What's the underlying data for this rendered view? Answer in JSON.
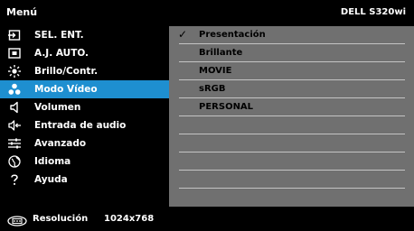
{
  "header": {
    "title": "Menú",
    "model": "DELL S320wi"
  },
  "menu": {
    "items": [
      {
        "label": "SEL. ENT.",
        "icon": "input-icon"
      },
      {
        "label": "A.J. AUTO.",
        "icon": "auto-adjust-icon"
      },
      {
        "label": "Brillo/Contr.",
        "icon": "brightness-icon"
      },
      {
        "label": "Modo Vídeo",
        "icon": "video-mode-icon",
        "active": true
      },
      {
        "label": "Volumen",
        "icon": "volume-icon"
      },
      {
        "label": "Entrada de audio",
        "icon": "audio-input-icon"
      },
      {
        "label": "Avanzado",
        "icon": "advanced-icon"
      },
      {
        "label": "Idioma",
        "icon": "language-icon"
      },
      {
        "label": "Ayuda",
        "icon": "help-icon"
      }
    ]
  },
  "submenu": {
    "items": [
      {
        "label": "Presentación",
        "checked": true,
        "check": "✓"
      },
      {
        "label": "Brillante",
        "checked": false
      },
      {
        "label": "MOVIE",
        "checked": false
      },
      {
        "label": "sRGB",
        "checked": false
      },
      {
        "label": "PERSONAL",
        "checked": false
      }
    ],
    "empty_rows": 5
  },
  "footer": {
    "label": "Resolución",
    "value": "1024x768",
    "icon": "resolution-icon"
  },
  "colors": {
    "highlight": "#1e8fd0",
    "panel": "#707070",
    "divider": "#c4c4c4",
    "background": "#000000"
  }
}
